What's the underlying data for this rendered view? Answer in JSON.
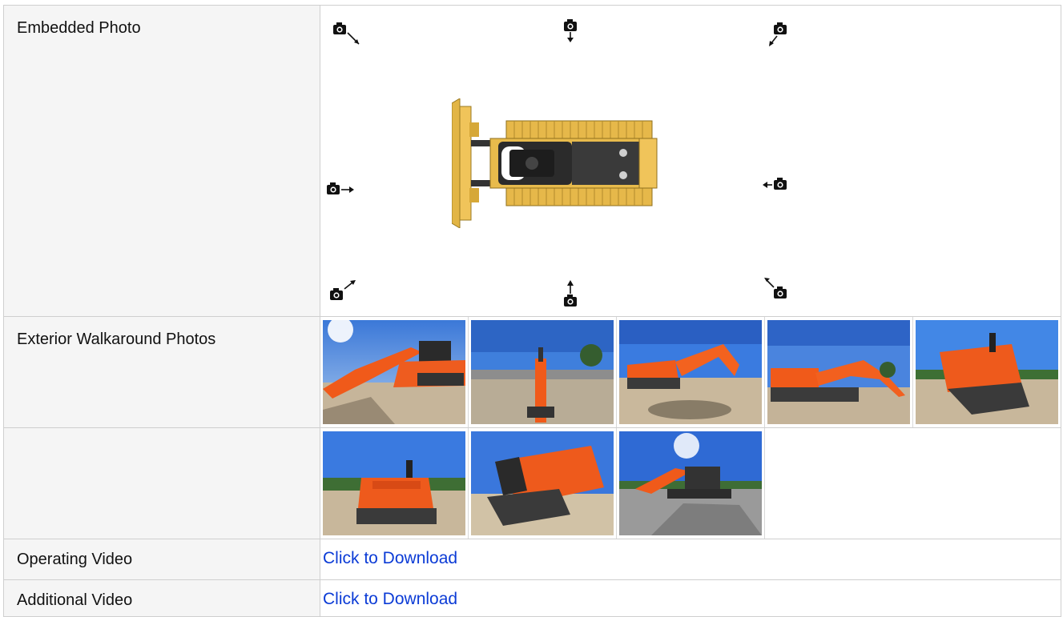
{
  "rows": {
    "embedded_photo": {
      "label": "Embedded Photo"
    },
    "exterior_photos": {
      "label": "Exterior Walkaround Photos",
      "thumb_count": 8
    },
    "extra_photos": {
      "label": ""
    },
    "operating_video": {
      "label": "Operating Video",
      "link": "Click to Download"
    },
    "additional_video": {
      "label": "Additional Video",
      "link": "Click to Download"
    }
  },
  "diagram": {
    "camera_icons": [
      "camera-top-left",
      "camera-top",
      "camera-top-right",
      "camera-left",
      "camera-right",
      "camera-bottom-left",
      "camera-bottom",
      "camera-bottom-right"
    ],
    "machine_icon": "bulldozer-top-view"
  },
  "thumbnails": {
    "row1": [
      "excavator-left-front-photo",
      "excavator-front-photo",
      "excavator-side-photo",
      "excavator-right-side-photo",
      "excavator-rear-quarter-photo"
    ],
    "row2": [
      "excavator-rear-photo",
      "excavator-left-rear-photo",
      "excavator-boom-photo"
    ]
  },
  "colors": {
    "link": "#0b3bd6",
    "label_bg": "#f5f5f5",
    "border": "#cfcfcf",
    "machine": "#ffffff",
    "sky": "#2f6fd0",
    "machine_orange": "#f05a1a",
    "ground": "#c8b79a"
  }
}
